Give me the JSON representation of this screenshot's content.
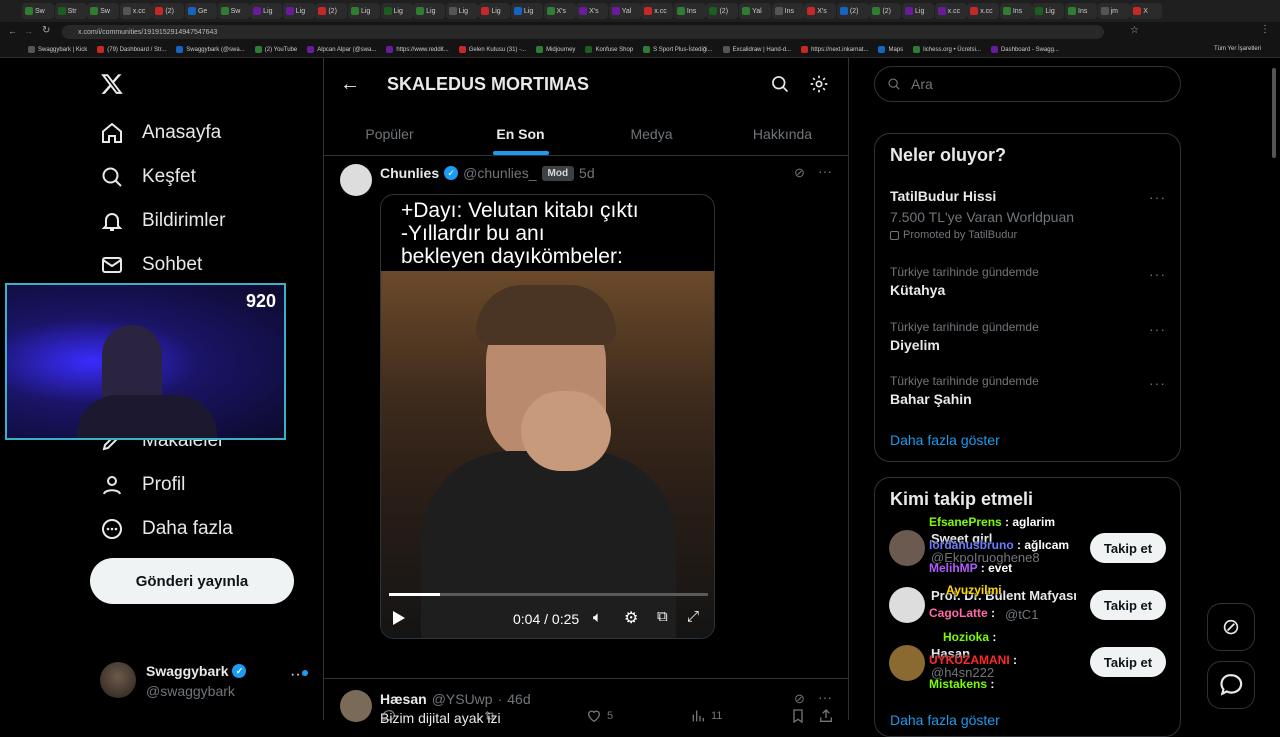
{
  "browser": {
    "tabs": [
      "Sw",
      "Str",
      "Sw",
      "x.cc",
      "(2)",
      "Ge",
      "Sw",
      "Lig",
      "Lig",
      "(2)",
      "Lig",
      "Lig",
      "Lig",
      "Lig",
      "Lig",
      "Lig",
      "X's",
      "X's",
      "Yal",
      "x.cc",
      "Ins",
      "(2)",
      "Yal",
      "Ins",
      "X's",
      "(2)",
      "(2)",
      "Lig",
      "x.cc",
      "x.cc",
      "Ins",
      "Lig",
      "Ins",
      "jm",
      "X"
    ],
    "url": "x.com/i/communities/1919152914947547643",
    "bookmarks": [
      "Swaggybark | Kick",
      "(79) Dashboard / Str...",
      "Swaggybark (@swa...",
      "(2) YouTube",
      "Alpcan Alpar (@swa...",
      "https://www.reddit...",
      "Gelen Kutusu (31) -...",
      "Midjourney",
      "Konfuse Shop",
      "S Sport Plus-İstediği...",
      "Excalidraw | Hand-d...",
      "https://next.inkarnat...",
      "Maps",
      "lichess.org • Ücretsi...",
      "Dashboard - Swagg..."
    ],
    "all_bookmarks": "Tüm Yer İşaretleri"
  },
  "sidebar": {
    "logo": "X",
    "items": [
      {
        "label": "Anasayfa",
        "icon": "home-icon"
      },
      {
        "label": "Keşfet",
        "icon": "search-icon"
      },
      {
        "label": "Bildirimler",
        "icon": "bell-icon"
      },
      {
        "label": "Sohbet",
        "icon": "mail-icon"
      },
      {
        "label": "Makaleler",
        "icon": "article-icon"
      },
      {
        "label": "Profil",
        "icon": "profile-icon"
      },
      {
        "label": "Daha fazla",
        "icon": "more-circle-icon"
      }
    ],
    "post_button": "Gönderi yayınla",
    "account": {
      "name": "Swaggybark",
      "handle": "@swaggybark"
    }
  },
  "webcam": {
    "viewer_count": "920"
  },
  "header": {
    "title": "SKALEDUS MORTIMAS"
  },
  "community_tabs": [
    "Popüler",
    "En Son",
    "Medya",
    "Hakkında"
  ],
  "active_tab": "En Son",
  "posts": [
    {
      "author": "Chunlies",
      "handle": "@chunlies_",
      "badge": "Mod",
      "time": "5d",
      "meme_text": "+Dayı: Velutan kitabı çıktı\n-Yıllardır bu anı\nbekleyen dayıkömbeler:",
      "video_time": "0:04 / 0:25",
      "video_progress": 0.16,
      "likes": "5",
      "views": "11"
    },
    {
      "author": "Hæsan",
      "handle": "@YSUwp",
      "time": "46d",
      "text": "Bizim dijital ayak izi"
    }
  ],
  "right": {
    "search_placeholder": "Ara",
    "trends_title": "Neler oluyor?",
    "trends": [
      {
        "meta": "TatilBudur Hissi",
        "name": "7.500 TL'ye Varan Worldpuan",
        "promoted": "Promoted by TatilBudur"
      },
      {
        "meta": "Türkiye tarihinde gündemde",
        "name": "Kütahya"
      },
      {
        "meta": "Türkiye tarihinde gündemde",
        "name": "Diyelim"
      },
      {
        "meta": "Türkiye tarihinde gündemde",
        "name": "Bahar Şahin"
      }
    ],
    "show_more": "Daha fazla göster",
    "who_to_follow_title": "Kimi takip etmeli",
    "follow_label": "Takip et",
    "suggestions": [
      {
        "name": "Sweet girl",
        "handle": "@EkpoIruoghene8"
      },
      {
        "name": "Prof. Dr. Bülent Mafyası",
        "handle": "@tC1"
      },
      {
        "name": "Hasan",
        "handle": "@h4sn222"
      }
    ],
    "show_more_2": "Daha fazla göster"
  },
  "chat_overlay": [
    {
      "user": "EfsanePrens",
      "msg": ": aglarim",
      "color": "#7cfc00"
    },
    {
      "user": "lordanusbruno",
      "msg": ": ağlıcam",
      "color": "#6a7cff"
    },
    {
      "user": "MelihMP",
      "msg": ": evet",
      "color": "#b05cff"
    },
    {
      "user": "Ayuzyilmi",
      "msg": "",
      "color": "#ffd700"
    },
    {
      "user": "CagoLatte",
      "msg": ":",
      "color": "#ff6aa8"
    },
    {
      "user": "Hozioka",
      "msg": ":",
      "color": "#7cfc00"
    },
    {
      "user": "UYKUZAMANI",
      "msg": ":",
      "color": "#ff2a2a"
    },
    {
      "user": "Mistakens",
      "msg": ":",
      "color": "#7cfc00"
    }
  ],
  "colors": {
    "accent": "#1d9bf0",
    "background": "#000000",
    "border": "#2f3336",
    "muted": "#71767b"
  }
}
